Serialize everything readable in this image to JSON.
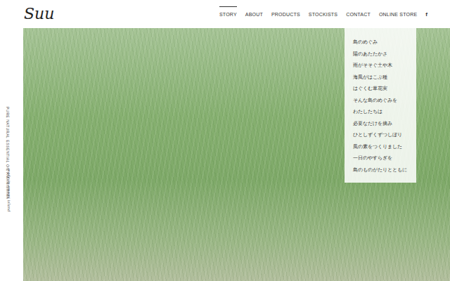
{
  "logo": "Suu",
  "nav": [
    {
      "label": "STORY",
      "selected": true
    },
    {
      "label": "ABOUT",
      "selected": false
    },
    {
      "label": "PRODUCTS",
      "selected": false
    },
    {
      "label": "STOCKISTS",
      "selected": false
    },
    {
      "label": "CONTACT",
      "selected": false
    },
    {
      "label": "ONLINE STORE",
      "selected": false
    }
  ],
  "social": "f",
  "side_texts": [
    "PURE NATURAL ESSENTIAL OIL AMAMISHIMA",
    "made in amami island"
  ],
  "hero": {
    "poem": [
      "島のめぐみ",
      "陽のあたたかさ",
      "雨がそそぐ土や木",
      "海風がはこぶ種",
      "はぐくむ草花実",
      "そんな島のめぐみを",
      "わたしたちは",
      "必要なだけを摘み",
      "ひとしずくずつしぼり",
      "風の素をつくりました",
      "一日のやすらぎを",
      "島のものがたりとともに"
    ]
  }
}
